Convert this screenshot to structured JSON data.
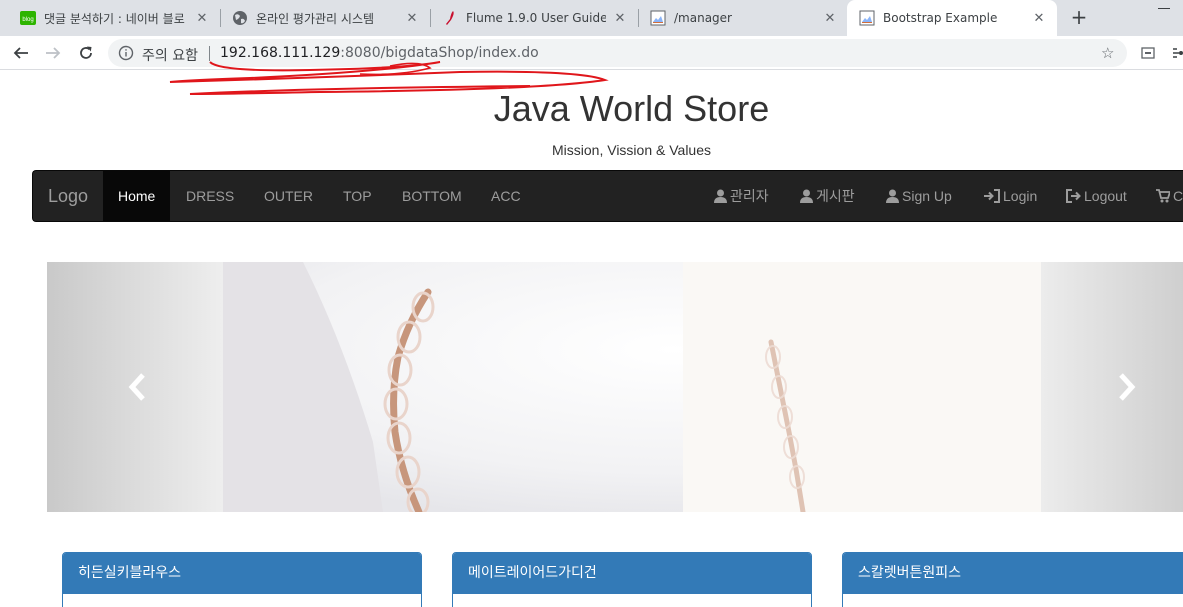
{
  "browser": {
    "tabs": [
      {
        "title": "댓글 분석하기 : 네이버 블로",
        "favicon": "naver-blog-icon"
      },
      {
        "title": "온라인 평가관리 시스템",
        "favicon": "globe-icon"
      },
      {
        "title": "Flume 1.9.0 User Guide —",
        "favicon": "feather-icon"
      },
      {
        "title": "/manager",
        "favicon": "broken-image-icon"
      },
      {
        "title": "Bootstrap Example",
        "favicon": "broken-image-icon"
      }
    ],
    "active_tab_index": 4,
    "blog_badge": "blog",
    "new_tab": "+",
    "close_glyph": "✕",
    "address": {
      "security_label": "주의 요함",
      "url_host": "192.168.111.129",
      "url_path": ":8080/bigdataShop/index.do"
    },
    "bookmark_star": "☆"
  },
  "page": {
    "title": "Java World Store",
    "subtitle": "Mission, Vission & Values",
    "navbar": {
      "brand": "Logo",
      "left_items": [
        "Home",
        "DRESS",
        "OUTER",
        "TOP",
        "BOTTOM",
        "ACC"
      ],
      "active_item": "Home",
      "right_items": [
        {
          "label": "관리자",
          "icon": "user-icon"
        },
        {
          "label": "게시판",
          "icon": "user-icon"
        },
        {
          "label": "Sign Up",
          "icon": "user-icon"
        },
        {
          "label": "Login",
          "icon": "log-in-icon"
        },
        {
          "label": "Logout",
          "icon": "log-out-icon"
        },
        {
          "label": "C",
          "icon": "shopping-cart-icon"
        }
      ]
    },
    "panels": [
      {
        "heading": "히든실키블라우스"
      },
      {
        "heading": "메이트레이어드가디건"
      },
      {
        "heading": "스칼렛버튼원피스"
      }
    ]
  },
  "colors": {
    "navbar_bg": "#222222",
    "panel_primary": "#337ab7",
    "scribble": "#e0161b"
  }
}
